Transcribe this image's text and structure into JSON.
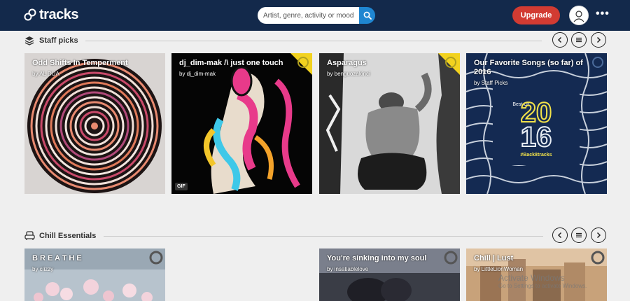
{
  "app": {
    "logo_text": "tracks"
  },
  "search": {
    "placeholder": "Artist, genre, activity or mood"
  },
  "header": {
    "upgrade_label": "Upgrade",
    "more_label": "•••"
  },
  "sections": [
    {
      "title": "Staff picks",
      "cards": [
        {
          "title": "Odd Shifts In Temperment",
          "by": "by AL DUA"
        },
        {
          "title": "dj_dim-mak /\\ just one touch",
          "by": "by dj_dim-mak",
          "badge": "GIF"
        },
        {
          "title": "Asparagus",
          "by": "by benguozakinci"
        },
        {
          "title": "Our Favorite Songs (so far) of 2016",
          "by": "by Staff Picks",
          "art_text": {
            "best": "Best Of",
            "year_top": "20",
            "year_bottom": "16",
            "hashtag": "#Back8tracks"
          }
        }
      ]
    },
    {
      "title": "Chill Essentials",
      "cards": [
        {
          "title": "B R E A T H E",
          "by": "by clizzy"
        },
        {
          "title": "You're sinking into my soul",
          "by": "by insatiablelove"
        },
        {
          "title": "Chill | Lust",
          "by": "by LittleLionWoman"
        }
      ]
    }
  ],
  "watermark": {
    "title": "Activate Windows",
    "subtitle": "Go to Settings to activate Windows."
  },
  "colors": {
    "topbar": "#13294b",
    "accent": "#1f86d1",
    "upgrade": "#d23b32",
    "corner": "#f2d21f"
  }
}
